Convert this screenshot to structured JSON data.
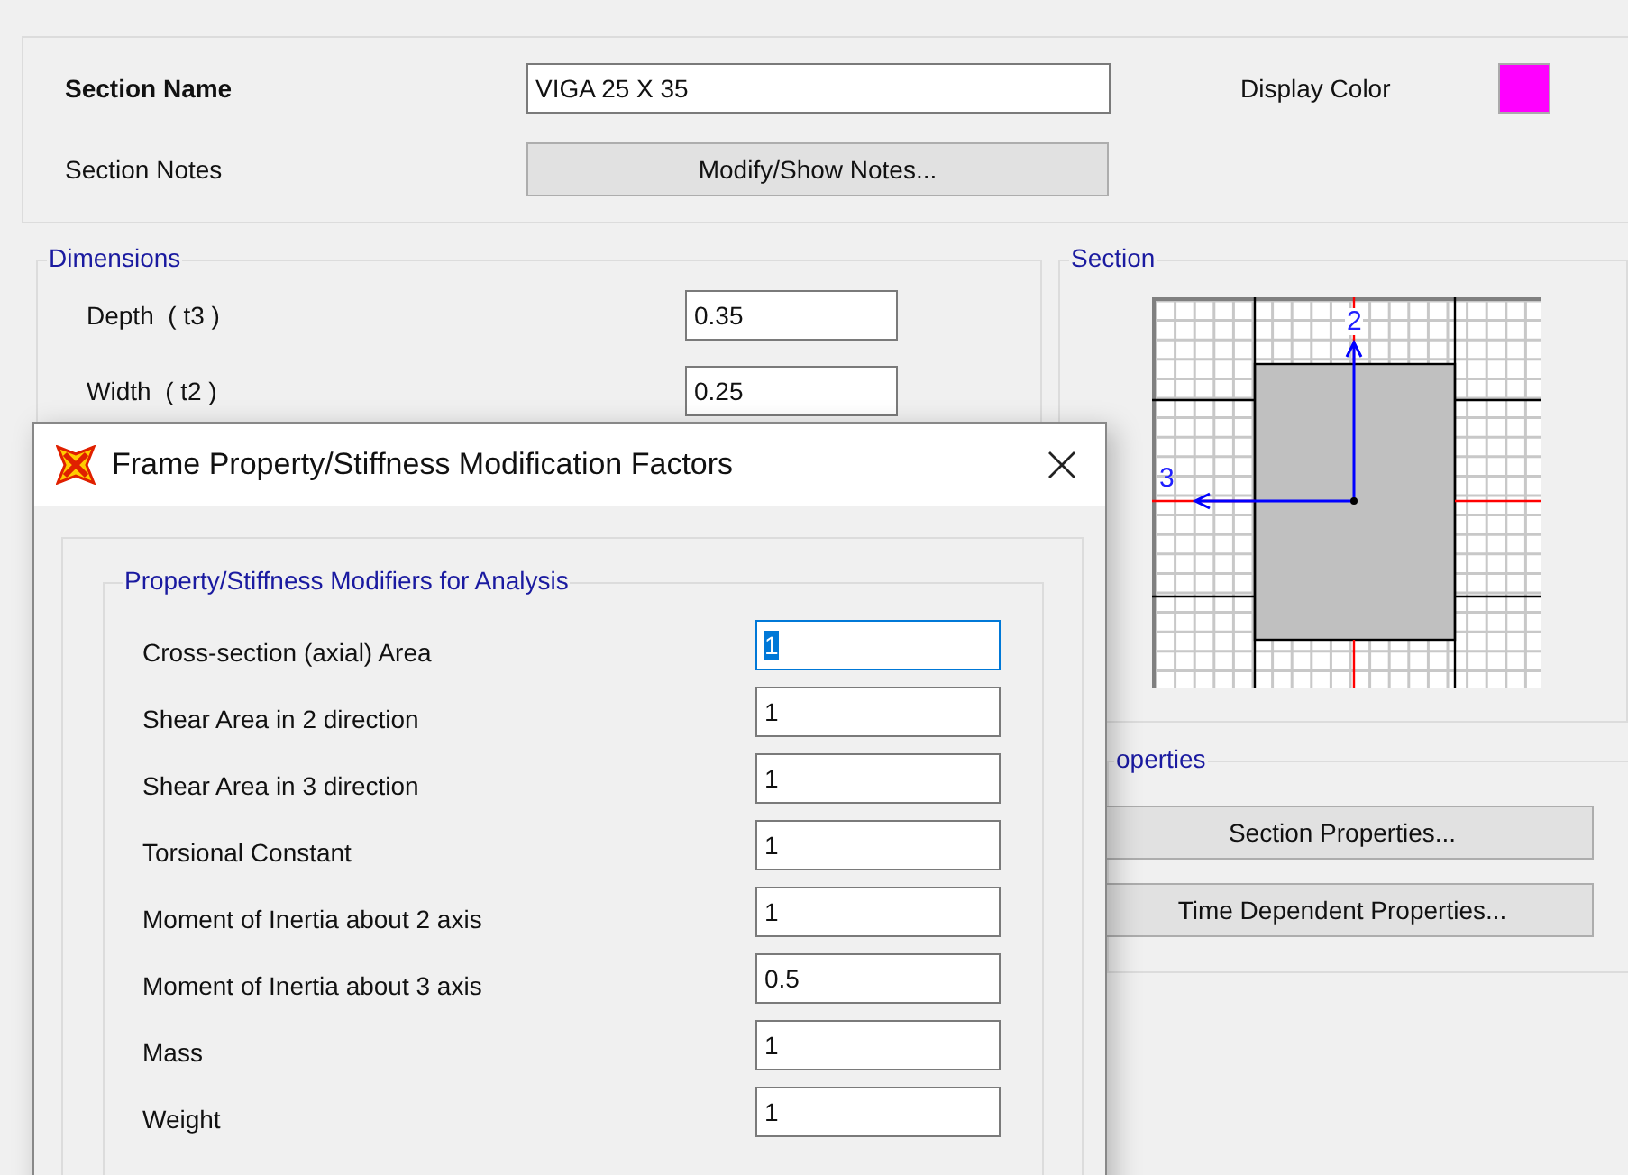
{
  "section": {
    "name_label": "Section Name",
    "name_value": "VIGA 25 X 35",
    "display_color_label": "Display Color",
    "color": "#ff00ff",
    "notes_label": "Section Notes",
    "notes_button": "Modify/Show Notes..."
  },
  "dimensions": {
    "title": "Dimensions",
    "fields": [
      {
        "label": "Depth  ( t3 )",
        "value": "0.35"
      },
      {
        "label": "Width  ( t2 )",
        "value": "0.25"
      }
    ]
  },
  "section_view": {
    "title": "Section",
    "axis_labels": [
      "2",
      "3"
    ]
  },
  "properties": {
    "title": "operties",
    "buttons": [
      "Section Properties...",
      "Time Dependent Properties..."
    ]
  },
  "dialog": {
    "title": "Frame Property/Stiffness Modification Factors",
    "group_title": "Property/Stiffness Modifiers for Analysis",
    "modifiers": [
      {
        "label": "Cross-section (axial) Area",
        "value": "1",
        "focused": true
      },
      {
        "label": "Shear Area in 2 direction",
        "value": "1",
        "focused": false
      },
      {
        "label": "Shear Area in 3 direction",
        "value": "1",
        "focused": false
      },
      {
        "label": "Torsional Constant",
        "value": "1",
        "focused": false
      },
      {
        "label": "Moment of Inertia about 2 axis",
        "value": "1",
        "focused": false
      },
      {
        "label": "Moment of Inertia about 3 axis",
        "value": "0.5",
        "focused": false
      },
      {
        "label": "Mass",
        "value": "1",
        "focused": false
      },
      {
        "label": "Weight",
        "value": "1",
        "focused": false
      }
    ]
  }
}
